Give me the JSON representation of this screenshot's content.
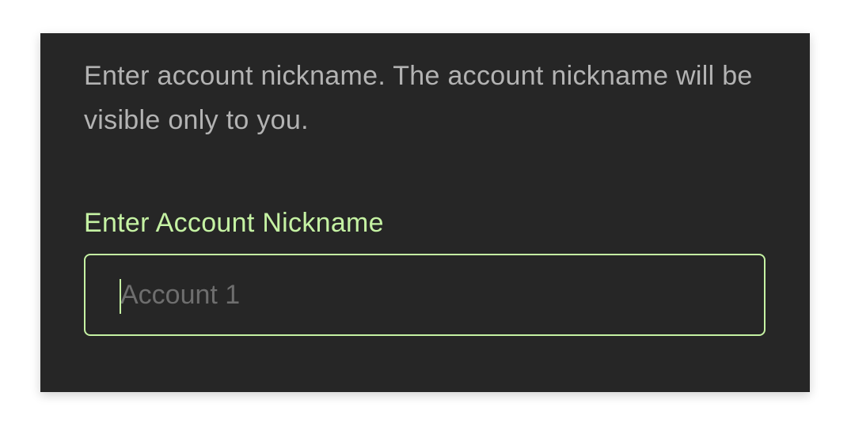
{
  "nickname_dialog": {
    "description": "Enter account nickname. The account nickname will be visible only to you.",
    "field_label": "Enter Account Nickname",
    "input_value": "",
    "input_placeholder": "Account 1",
    "accent_color": "#c5f2a3",
    "background_color": "#262626"
  }
}
